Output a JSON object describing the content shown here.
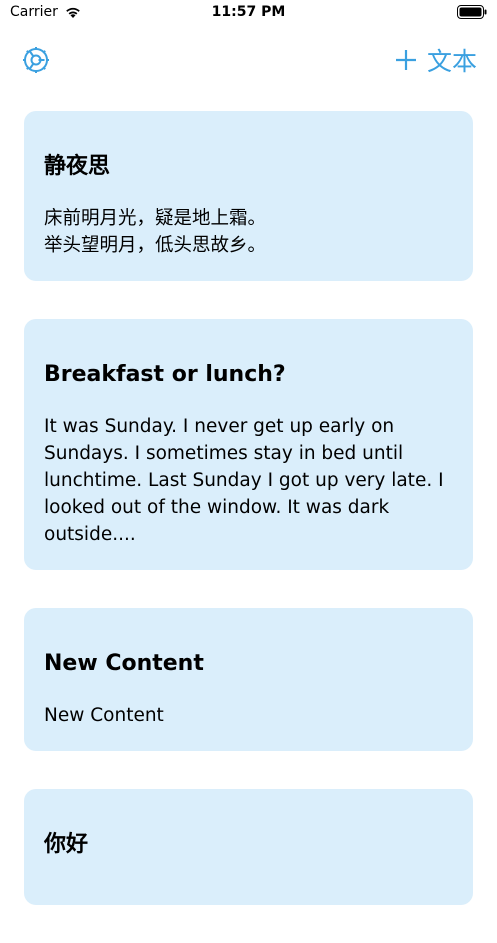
{
  "status_bar": {
    "carrier": "Carrier",
    "time": "11:57 PM"
  },
  "nav": {
    "settings_icon": "gear-icon",
    "add_icon": "plus-icon",
    "add_label": "文本",
    "accent_color": "#3aa0e0"
  },
  "cards": [
    {
      "title": "静夜思",
      "body": "床前明月光，疑是地上霜。\n举头望明月，低头思故乡。"
    },
    {
      "title": "Breakfast or lunch?",
      "body": "It was Sunday. I never get up early on Sundays. I sometimes stay in bed until lunchtime. Last Sunday I got up very late. I looked out of the window. It was dark outside...."
    },
    {
      "title": "New Content",
      "body": "New Content"
    },
    {
      "title": "你好",
      "body": ""
    }
  ],
  "card_color": "#daeefb"
}
